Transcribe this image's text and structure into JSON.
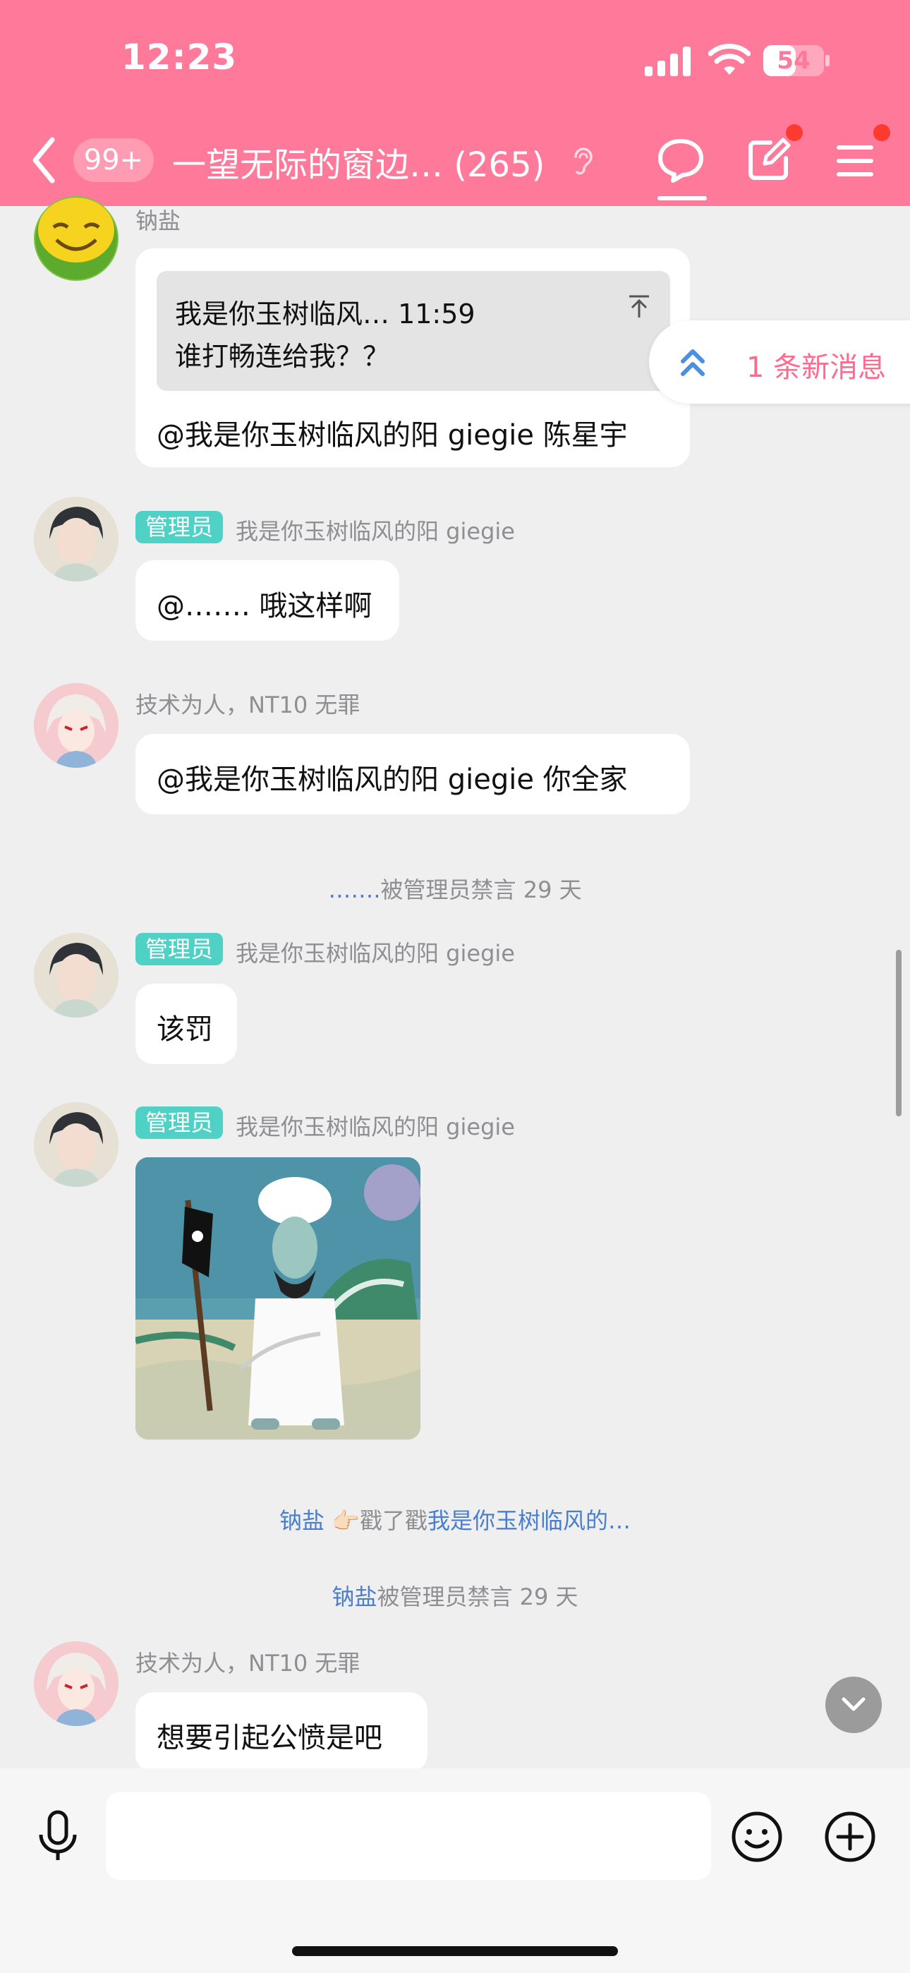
{
  "status_bar": {
    "time": "12:23",
    "battery": "54",
    "battery_percent": 54
  },
  "header": {
    "unread_badge": "99+",
    "group_title": "一望无际的窗边… (265)",
    "icons": [
      "chevron-left-icon",
      "ear-icon",
      "chat-bubble-icon",
      "edit-icon",
      "menu-icon"
    ],
    "accent_color": "#ff7a9a"
  },
  "new_message_pill": {
    "text": "1 条新消息",
    "icon": "double-chevron-up-icon"
  },
  "messages": [
    {
      "sender": "钠盐",
      "quote": {
        "header": "我是你玉树临风… 11:59",
        "text": "谁打畅连给我？？"
      },
      "text": "@我是你玉树临风的阳 giegie 陈星宇"
    },
    {
      "badge": "管理员",
      "sender": "我是你玉树临风的阳 giegie",
      "text": "@……. 哦这样啊"
    },
    {
      "sender": "技术为人，NT10 无罪",
      "text": "@我是你玉树临风的阳 giegie 你全家"
    },
    {
      "badge": "管理员",
      "sender": "我是你玉树临风的阳 giegie",
      "text": "该罚"
    },
    {
      "badge": "管理员",
      "sender": "我是你玉树临风的阳 giegie",
      "image": "squidward-meme-image"
    },
    {
      "sender": "技术为人，NT10 无罪",
      "text": "想要引起公愤是吧"
    }
  ],
  "system_notices": [
    {
      "link": "…….",
      "text": "被管理员禁言 29 天"
    },
    {
      "link": "钠盐",
      "emoji": "👉🏻",
      "text": "戳了戳",
      "link2": "我是你玉树临风的…"
    },
    {
      "link": "钠盐",
      "text": "被管理员禁言 29 天"
    }
  ],
  "input_bar": {
    "placeholder": "",
    "icons": [
      "microphone-icon",
      "emoji-icon",
      "plus-icon"
    ]
  }
}
